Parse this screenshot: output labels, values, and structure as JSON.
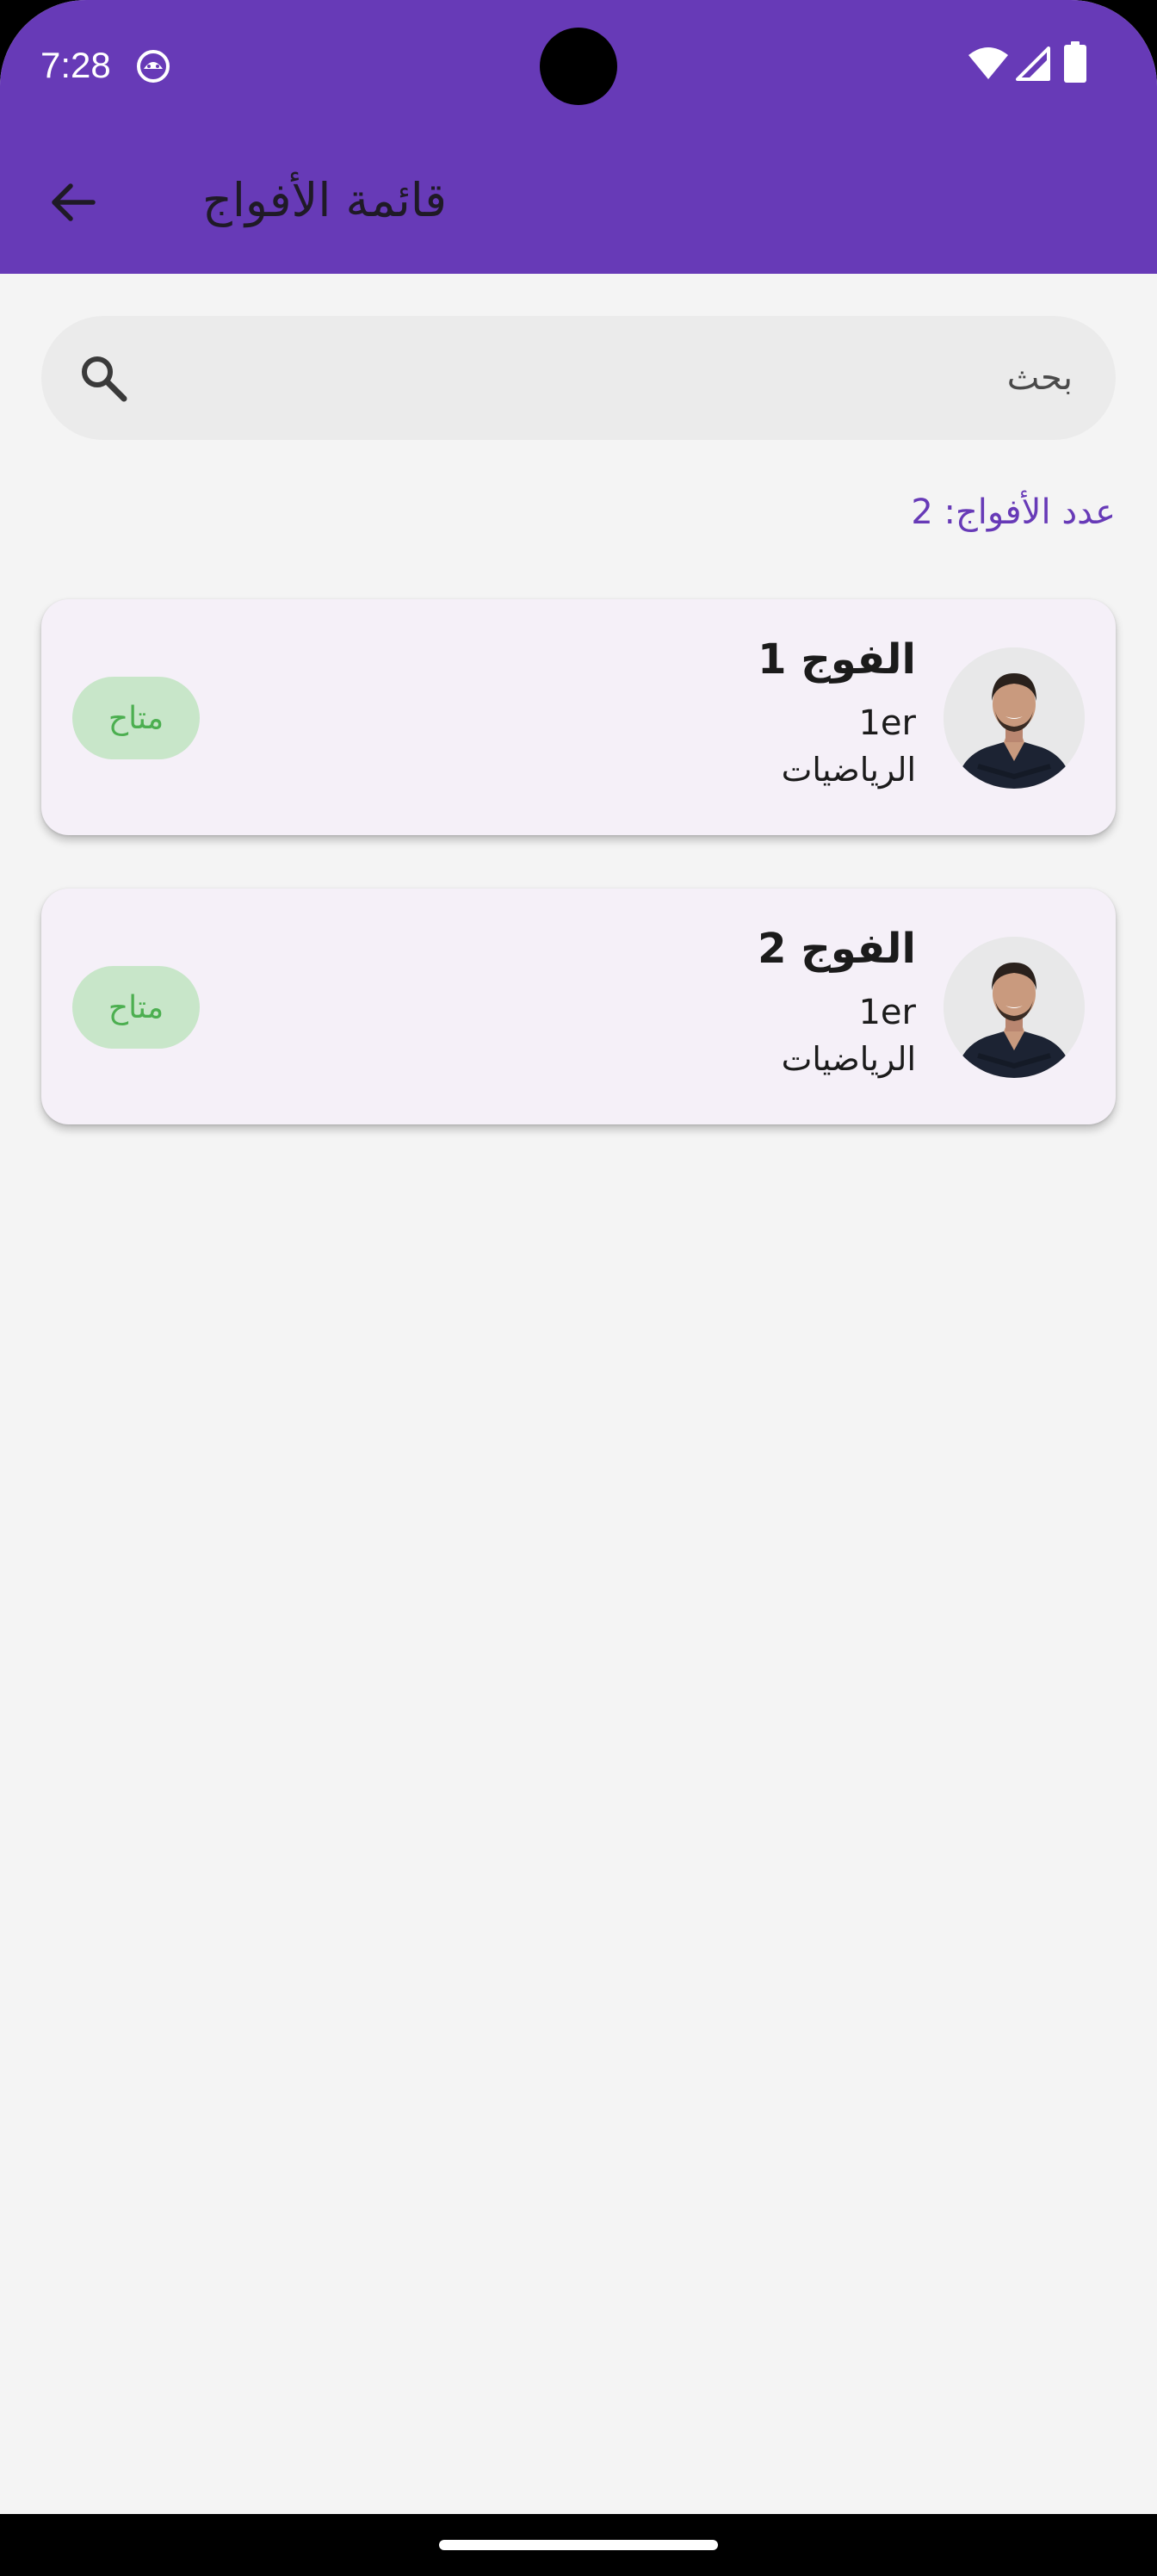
{
  "status_bar": {
    "time": "7:28",
    "notification_icon": "android-bot-icon",
    "wifi_icon": "wifi-icon",
    "signal_icon": "cell-signal-icon",
    "battery_icon": "battery-icon"
  },
  "app_bar": {
    "title": "قائمة الأفواج",
    "back_icon": "arrow-back-icon",
    "background": "#673AB7"
  },
  "search": {
    "placeholder": "بحث",
    "icon": "search-icon"
  },
  "summary": {
    "count_label": "عدد الأفواج: 2"
  },
  "groups": [
    {
      "name": "الفوج 1",
      "level": "1er",
      "subject": "الرياضيات",
      "status": "متاح"
    },
    {
      "name": "الفوج 2",
      "level": "1er",
      "subject": "الرياضيات",
      "status": "متاح"
    }
  ],
  "colors": {
    "primary": "#673AB7",
    "card_background": "#F5F0F8",
    "status_chip_bg": "#C8E6C9",
    "status_chip_text": "#4CAF50"
  }
}
